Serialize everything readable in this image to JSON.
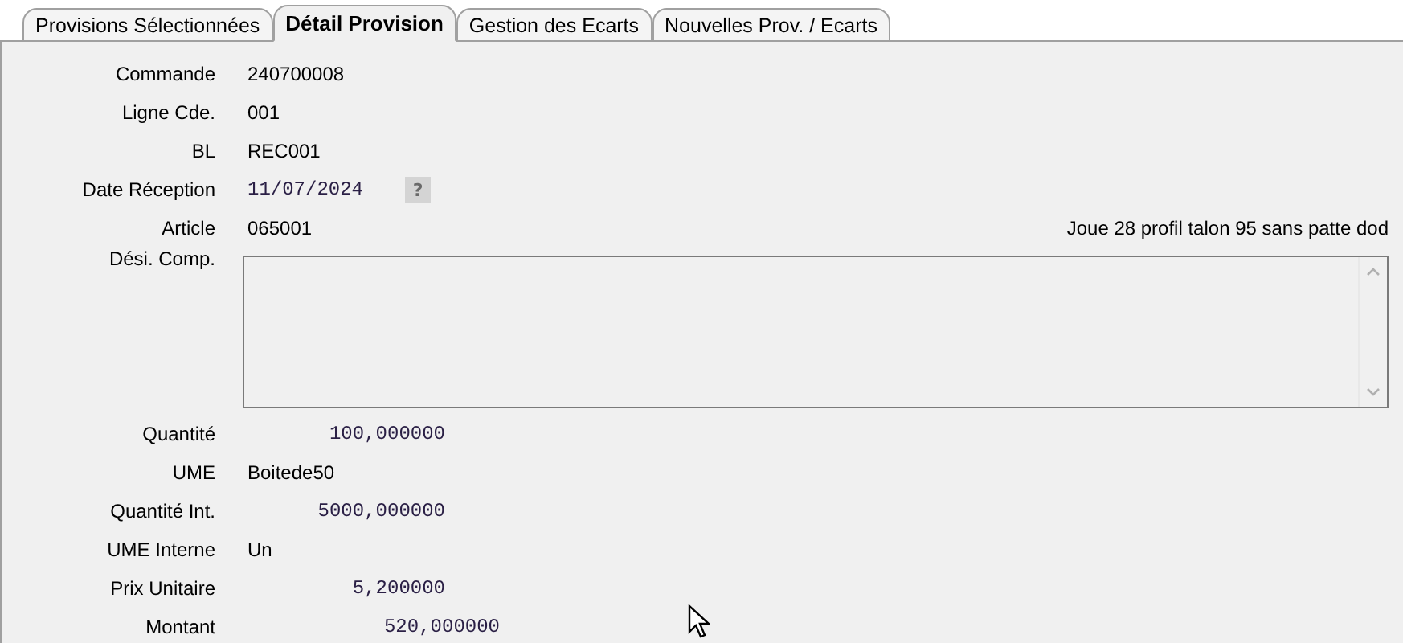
{
  "tabs": [
    {
      "label": "Provisions Sélectionnées",
      "selected": false
    },
    {
      "label": "Détail Provision",
      "selected": true
    },
    {
      "label": "Gestion des Ecarts",
      "selected": false
    },
    {
      "label": "Nouvelles Prov. / Ecarts",
      "selected": false
    }
  ],
  "fields": [
    {
      "kind": "text",
      "label": "Commande",
      "value": "240700008"
    },
    {
      "kind": "text",
      "label": "Ligne Cde.",
      "value": "001"
    },
    {
      "kind": "text",
      "label": "BL",
      "value": "REC001"
    },
    {
      "kind": "date",
      "label": "Date Réception",
      "value": "11/07/2024",
      "help": "?"
    },
    {
      "kind": "article",
      "label": "Article",
      "value": "065001",
      "description": "Joue 28 profil talon 95 sans patte dod"
    },
    {
      "kind": "memo",
      "label": "Dési. Comp."
    },
    {
      "kind": "number",
      "label": "Quantité",
      "value": "100,000000"
    },
    {
      "kind": "text",
      "label": "UME",
      "value": "Boitede50"
    },
    {
      "kind": "number",
      "label": "Quantité Int.",
      "value": "5000,000000"
    },
    {
      "kind": "text",
      "label": "UME Interne",
      "value": "Un"
    },
    {
      "kind": "number",
      "label": "Prix Unitaire",
      "value": "5,200000"
    },
    {
      "kind": "wide-number",
      "label": "Montant",
      "value": "520,000000"
    }
  ]
}
